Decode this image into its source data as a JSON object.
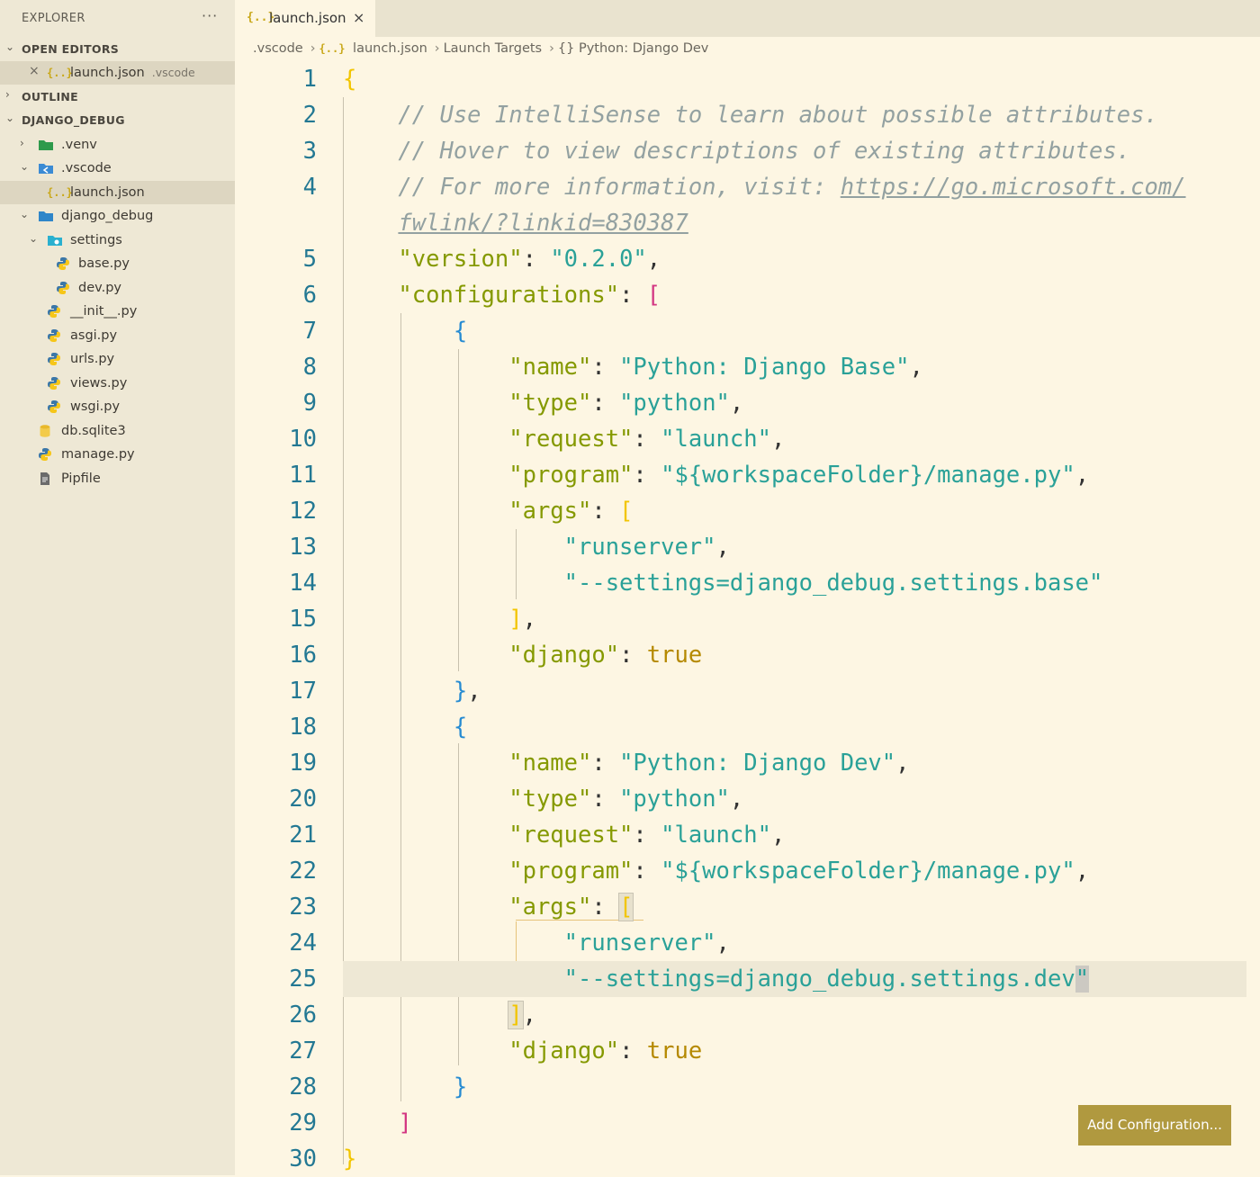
{
  "sidebar": {
    "title": "EXPLORER",
    "more": "···",
    "open_editors_label": "OPEN EDITORS",
    "open_editor": {
      "name": "launch.json",
      "desc": ".vscode"
    },
    "outline_label": "OUTLINE",
    "project_label": "DJANGO_DEBUG",
    "tree": [
      {
        "name": ".venv"
      },
      {
        "name": ".vscode"
      },
      {
        "name": "launch.json"
      },
      {
        "name": "django_debug"
      },
      {
        "name": "settings"
      },
      {
        "name": "base.py"
      },
      {
        "name": "dev.py"
      },
      {
        "name": "__init__.py"
      },
      {
        "name": "asgi.py"
      },
      {
        "name": "urls.py"
      },
      {
        "name": "views.py"
      },
      {
        "name": "wsgi.py"
      },
      {
        "name": "db.sqlite3"
      },
      {
        "name": "manage.py"
      },
      {
        "name": "Pipfile"
      }
    ]
  },
  "tab": {
    "label": "launch.json",
    "icon": "{..}",
    "close": "×"
  },
  "breadcrumb": [
    ".vscode",
    "launch.json",
    "Launch Targets",
    "{} Python: Django Dev"
  ],
  "lines": {
    "n": [
      "1",
      "2",
      "3",
      "4",
      "5",
      "6",
      "7",
      "8",
      "9",
      "10",
      "11",
      "12",
      "13",
      "14",
      "15",
      "16",
      "17",
      "18",
      "19",
      "20",
      "21",
      "22",
      "23",
      "24",
      "25",
      "26",
      "27",
      "28",
      "29",
      "30"
    ],
    "c2": "// Use IntelliSense to learn about possible attributes.",
    "c3": "// Hover to view descriptions of existing attributes.",
    "c4a": "// For more information, visit: ",
    "c4link1": "https://go.microsoft.com/",
    "c4link2": "fwlink/?linkid=830387",
    "k_version": "\"version\"",
    "v_version": "\"0.2.0\"",
    "k_configurations": "\"configurations\"",
    "k_name": "\"name\"",
    "v_name_base": "\"Python: Django Base\"",
    "v_name_dev": "\"Python: Django Dev\"",
    "k_type": "\"type\"",
    "v_type": "\"python\"",
    "k_request": "\"request\"",
    "v_request": "\"launch\"",
    "k_program": "\"program\"",
    "v_program": "\"${workspaceFolder}/manage.py\"",
    "k_args": "\"args\"",
    "v_runserver": "\"runserver\"",
    "v_settings_base": "\"--settings=django_debug.settings.base\"",
    "v_settings_dev_a": "\"--settings=django_debug.settings.dev",
    "v_settings_dev_b": "\"",
    "k_django": "\"django\"",
    "v_true": "true"
  },
  "add_configuration_label": "Add Configuration...",
  "colors": {
    "accent_button": "#b0993f",
    "background": "#fdf6e3",
    "sidebar": "#eee8d5"
  }
}
